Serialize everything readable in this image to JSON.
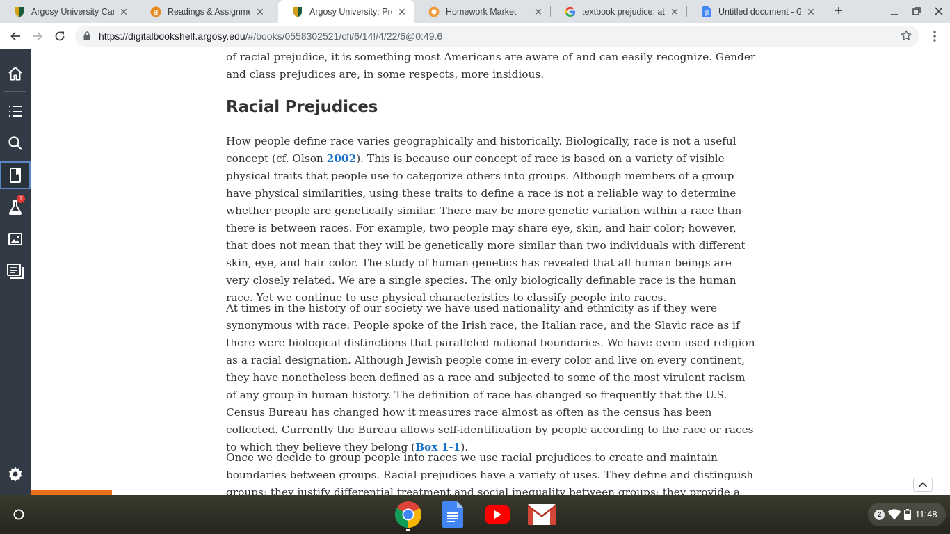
{
  "browser": {
    "tabs": [
      {
        "title": "Argosy University Campus",
        "icon": "argosy-shield-icon",
        "active": false
      },
      {
        "title": "Readings & Assignments",
        "icon": "b-orange-icon",
        "active": false
      },
      {
        "title": "Argosy University: Prejudice",
        "icon": "argosy-shield-icon",
        "active": true
      },
      {
        "title": "Homework Market",
        "icon": "homework-market-icon",
        "active": false
      },
      {
        "title": "textbook prejudice: attitudes",
        "icon": "google-g-icon",
        "active": false
      },
      {
        "title": "Untitled document - Google Docs",
        "icon": "google-docs-icon",
        "active": false
      }
    ],
    "url_host": "https://digitalbookshelf.argosy.edu",
    "url_path": "/#/books/0558302521/cfi/6/14!/4/22/6@0:49.6"
  },
  "sidebar": {
    "items": [
      "home-icon",
      "table-of-contents-icon",
      "search-icon",
      "book-icon",
      "flask-icon",
      "image-icon",
      "notes-icon"
    ],
    "flask_badge": "1",
    "settings": "gear-icon"
  },
  "book": {
    "para0": "of racial prejudice, it is something most Americans are aware of and can easily recognize. Gender and class prejudices are, in some respects, more insidious.",
    "heading": "Racial Prejudices",
    "para1_a": "How people define race varies geographically and historically. Biologically, race is not a useful concept (cf. Olson ",
    "para1_link": "2002",
    "para1_b": "). This is because our concept of race is based on a variety of visible physical traits that people use to categorize others into groups. Although members of a group have physical similarities, using these traits to define a race is not a reliable way to determine whether people are genetically similar. There may be more genetic variation within a race than there is between races. For example, two people may share eye, skin, and hair color; however, that does not mean that they will be genetically more similar than two individuals with different skin, eye, and hair color. The study of human genetics has revealed that all human beings are very closely related. We are a single species. The only biologically definable race is the human race. Yet we continue to use physical characteristics to classify people into races.",
    "para2_a": "At times in the history of our society we have used nationality and ethnicity as if they were synonymous with race. People spoke of the Irish race, the Italian race, and the Slavic race as if there were biological distinctions that paralleled national boundaries. We have even used religion as a racial designation. Although Jewish people come in every color and live on every continent, they have nonetheless been defined as a race and subjected to some of the most virulent racism of any group in human history. The definition of race has changed so frequently that the U.S. Census Bureau has changed how it measures race almost as often as the census has been collected. Currently the Bureau allows self-identification by people according to the race or races to which they believe they belong (",
    "para2_link": "Box 1-1",
    "para2_b": ").",
    "para3": "Once we decide to group people into races we use racial prejudices to create and maintain boundaries between groups. Racial prejudices have a variety of uses. They define and distinguish groups; they justify differential treatment and social inequality between groups; they provide a rationale for social decisions"
  },
  "shelf": {
    "apps": [
      "chrome-icon",
      "google-docs-icon",
      "youtube-icon",
      "gmail-icon"
    ],
    "notification_count": "2",
    "time": "11:48"
  }
}
